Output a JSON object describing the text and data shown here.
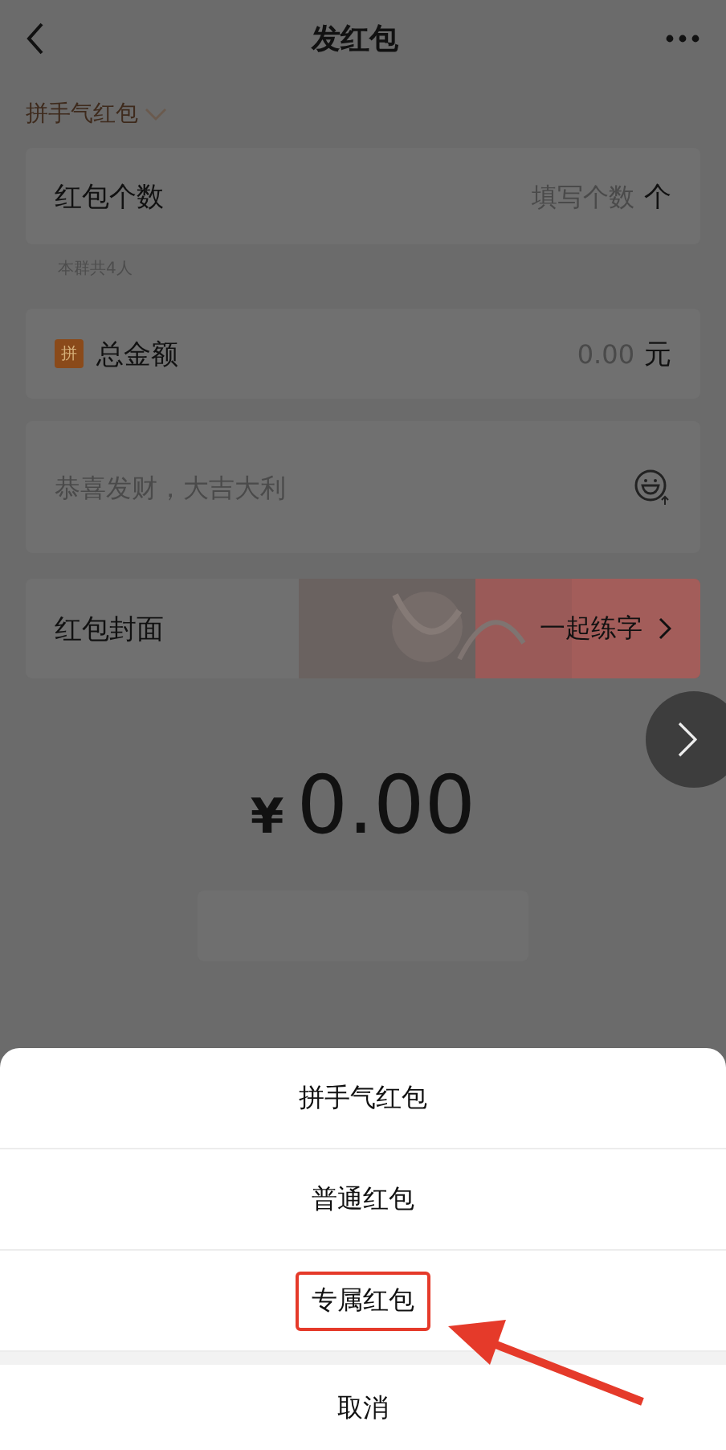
{
  "header": {
    "title": "发红包"
  },
  "type_selector": {
    "label": "拼手气红包"
  },
  "count_row": {
    "label": "红包个数",
    "placeholder": "填写个数",
    "unit": "个"
  },
  "group_note": "本群共4人",
  "amount_row": {
    "badge": "拼",
    "label": "总金额",
    "placeholder": "0.00",
    "unit": "元"
  },
  "message": {
    "placeholder": "恭喜发财，大吉大利"
  },
  "cover_row": {
    "label": "红包封面",
    "value": "一起练字"
  },
  "total": {
    "currency": "¥",
    "amount": "0.00"
  },
  "sheet": {
    "options": [
      {
        "label": "拼手气红包",
        "highlighted": false
      },
      {
        "label": "普通红包",
        "highlighted": false
      },
      {
        "label": "专属红包",
        "highlighted": true
      }
    ],
    "cancel": "取消"
  }
}
